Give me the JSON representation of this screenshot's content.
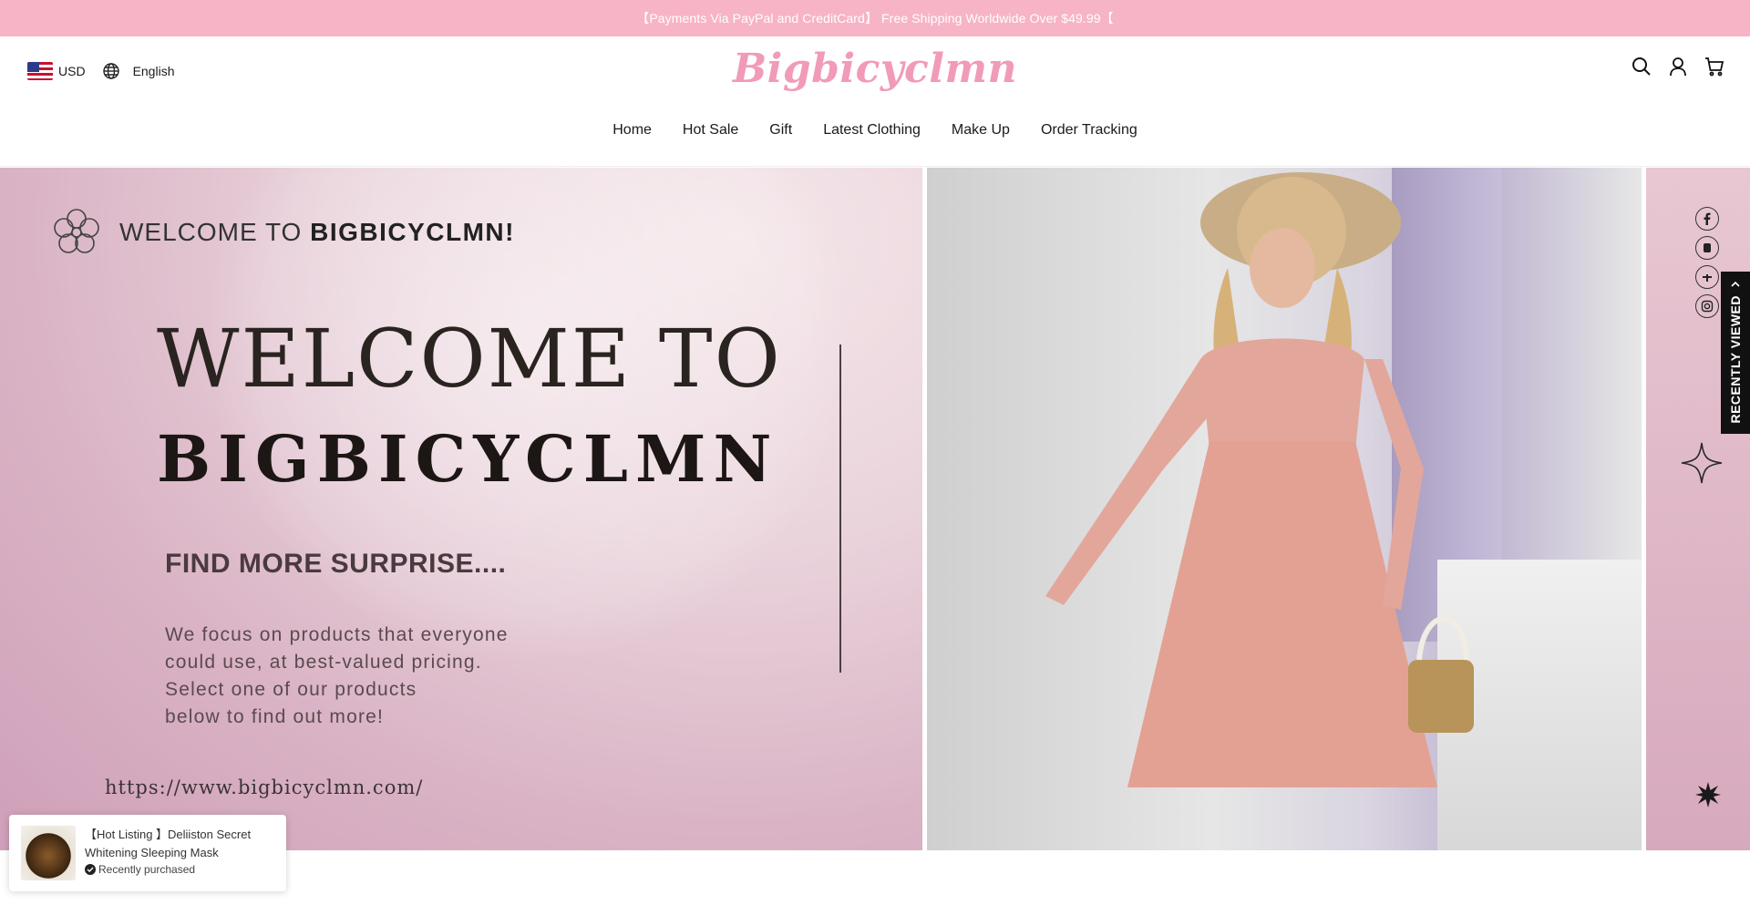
{
  "announcement": "【Payments Via PayPal and CreditCard】 Free Shipping Worldwide Over $49.99【",
  "header": {
    "currency": "USD",
    "language": "English",
    "logo_text": "Bigbicyclmn",
    "nav": [
      "Home",
      "Hot Sale",
      "Gift",
      "Latest Clothing",
      "Make Up",
      "Order Tracking"
    ]
  },
  "hero": {
    "welcome_small_prefix": "WELCOME TO",
    "welcome_small_brand": "BIGBICYCLMN!",
    "welcome_big": "WELCOME TO",
    "brand_big": "BIGBICYCLMN",
    "find_more": "FIND MORE SURPRISE....",
    "description_lines": [
      "We focus on products that everyone",
      "could use, at best-valued pricing.",
      "Select one of our products",
      "below to find out more!"
    ],
    "url": "https://www.bigbicyclmn.com/"
  },
  "recently_viewed": "RECENTLY VIEWED",
  "popup": {
    "title": "【Hot Listing 】Deliiston Secret Whitening Sleeping Mask",
    "status": "Recently purchased"
  },
  "colors": {
    "announcement_bg": "#f7b4c6",
    "logo": "#f19ab9",
    "accent_dark": "#111111"
  },
  "icons": [
    "globe-icon",
    "search-icon",
    "account-icon",
    "cart-icon",
    "facebook-icon",
    "tiktok-icon",
    "pinterest-icon",
    "instagram-icon",
    "chevron-up-icon",
    "check-circle-icon"
  ]
}
